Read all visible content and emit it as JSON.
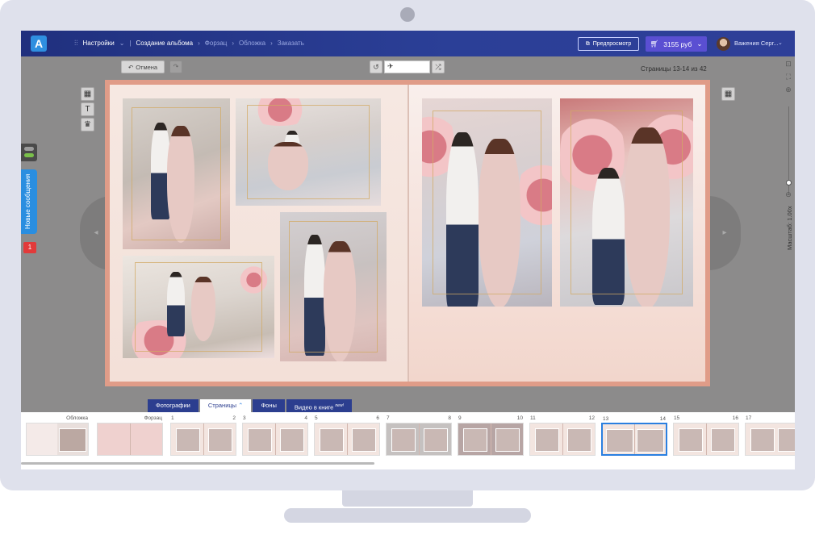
{
  "nav": {
    "settings": "Настройки",
    "create_album": "Создание альбома",
    "forzac": "Форзац",
    "cover": "Обложка",
    "order": "Заказать"
  },
  "header": {
    "logo": "A",
    "preview": "Предпросмотр",
    "price": "3155 руб",
    "username": "Вaжения Серг..."
  },
  "toolbar": {
    "undo": "Отмена",
    "pages": "Страницы 13-14 из 42"
  },
  "side": {
    "messages": "Новые сообщения",
    "badge": "1",
    "zoom": "Масштаб: 1.00x"
  },
  "tabs": {
    "photos": "Фотографии",
    "pages": "Страницы",
    "backgrounds": "Фоны",
    "video": "Видео в книге",
    "video_badge": "new!"
  },
  "thumbnails": [
    {
      "left": "",
      "right": "Обложка"
    },
    {
      "left": "",
      "right": "Форзац"
    },
    {
      "left": "1",
      "right": "2"
    },
    {
      "left": "3",
      "right": "4"
    },
    {
      "left": "5",
      "right": "6"
    },
    {
      "left": "7",
      "right": "8"
    },
    {
      "left": "9",
      "right": "10"
    },
    {
      "left": "11",
      "right": "12"
    },
    {
      "left": "13",
      "right": "14"
    },
    {
      "left": "15",
      "right": "16"
    },
    {
      "left": "17",
      "right": ""
    }
  ],
  "colors": {
    "nav_bg": "#2b3f97",
    "accent": "#5a4fd2",
    "tab_bg": "#2c3e8f",
    "selected_thumb": "#2a7fe0"
  }
}
